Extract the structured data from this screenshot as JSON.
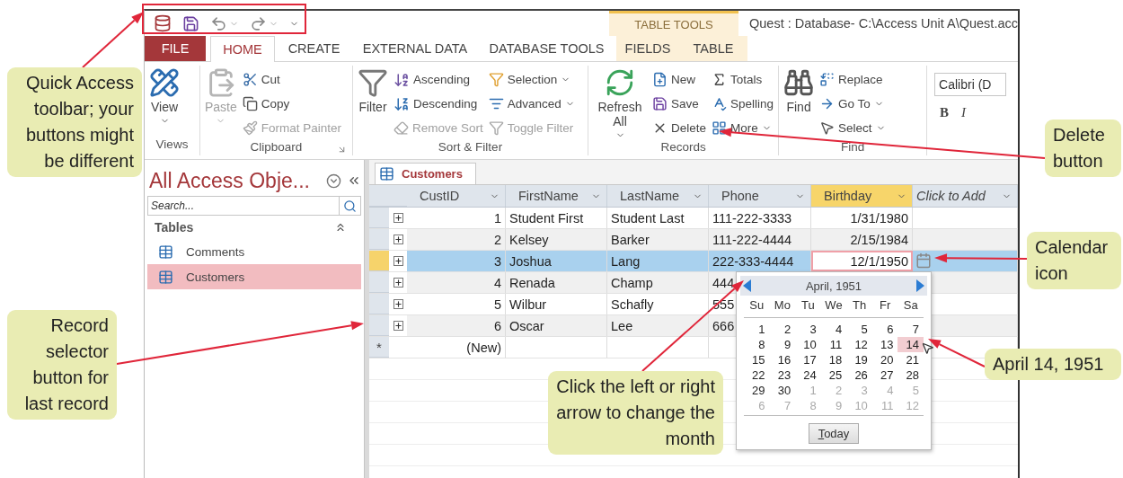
{
  "quick_access": {
    "title": "Quest : Database- C:\\Access Unit A\\Quest.acc",
    "context_group": "TABLE TOOLS"
  },
  "tabs": [
    {
      "label": "FILE",
      "kind": "file",
      "selected": false
    },
    {
      "label": "HOME",
      "kind": "normal",
      "selected": true
    },
    {
      "label": "CREATE",
      "kind": "normal",
      "selected": false
    },
    {
      "label": "EXTERNAL DATA",
      "kind": "normal",
      "selected": false
    },
    {
      "label": "DATABASE TOOLS",
      "kind": "normal",
      "selected": false
    },
    {
      "label": "FIELDS",
      "kind": "contextual",
      "selected": false
    },
    {
      "label": "TABLE",
      "kind": "contextual",
      "selected": false
    }
  ],
  "ribbon": {
    "groups": [
      {
        "label": "Views",
        "launcher": false,
        "large": {
          "label": "View",
          "disabled": false,
          "dropdown": true
        }
      },
      {
        "label": "Clipboard",
        "launcher": true,
        "large": {
          "label": "Paste",
          "disabled": true,
          "dropdown": true
        },
        "columns": [
          [
            {
              "label": "Cut",
              "disabled": false,
              "dropdown": false
            },
            {
              "label": "Copy",
              "disabled": false,
              "dropdown": false
            },
            {
              "label": "Format Painter",
              "disabled": true,
              "dropdown": false
            }
          ]
        ]
      },
      {
        "label": "Sort & Filter",
        "launcher": false,
        "large": {
          "label": "Filter",
          "disabled": false,
          "dropdown": false
        },
        "columns": [
          [
            {
              "label": "Ascending",
              "disabled": false,
              "dropdown": false
            },
            {
              "label": "Descending",
              "disabled": false,
              "dropdown": false
            },
            {
              "label": "Remove Sort",
              "disabled": true,
              "dropdown": false
            }
          ],
          [
            {
              "label": "Selection",
              "disabled": false,
              "dropdown": true
            },
            {
              "label": "Advanced",
              "disabled": false,
              "dropdown": true
            },
            {
              "label": "Toggle Filter",
              "disabled": true,
              "dropdown": false
            }
          ]
        ]
      },
      {
        "label": "Records",
        "launcher": false,
        "large": {
          "label": "Refresh All",
          "disabled": false,
          "dropdown": true
        },
        "columns": [
          [
            {
              "label": "New",
              "disabled": false,
              "dropdown": false
            },
            {
              "label": "Save",
              "disabled": false,
              "dropdown": false
            },
            {
              "label": "Delete",
              "disabled": false,
              "dropdown": false
            }
          ],
          [
            {
              "label": "Totals",
              "disabled": false,
              "dropdown": false
            },
            {
              "label": "Spelling",
              "disabled": false,
              "dropdown": false
            },
            {
              "label": "More",
              "disabled": false,
              "dropdown": true
            }
          ]
        ]
      },
      {
        "label": "Find",
        "launcher": false,
        "large": {
          "label": "Find",
          "disabled": false,
          "dropdown": false
        },
        "columns": [
          [
            {
              "label": "Replace",
              "disabled": false,
              "dropdown": false
            },
            {
              "label": "Go To",
              "disabled": false,
              "dropdown": true
            },
            {
              "label": "Select",
              "disabled": false,
              "dropdown": true
            }
          ]
        ]
      }
    ],
    "font_group": {
      "font": "Calibri (D",
      "buttons": [
        "B",
        "I"
      ]
    }
  },
  "navigation": {
    "title": "All Access Obje...",
    "search": {
      "placeholder": "Search..."
    },
    "groups": [
      {
        "label": "Tables",
        "expanded": true,
        "items": [
          {
            "label": "Comments",
            "selected": false
          },
          {
            "label": "Customers",
            "selected": true
          }
        ]
      }
    ]
  },
  "datasheet": {
    "tab": "Customers",
    "columns": [
      {
        "label": "CustID",
        "kind": "field",
        "selected": false
      },
      {
        "label": "FirstName",
        "kind": "field",
        "selected": false
      },
      {
        "label": "LastName",
        "kind": "field",
        "selected": false
      },
      {
        "label": "Phone",
        "kind": "field",
        "selected": false
      },
      {
        "label": "Birthday",
        "kind": "field",
        "selected": true
      },
      {
        "label": "Click to Add",
        "kind": "add",
        "selected": false
      }
    ],
    "rows": [
      {
        "kind": "record",
        "selected": false,
        "cells": [
          "1",
          "Student First",
          "Student Last",
          "111-222-3333",
          "1/31/1980"
        ]
      },
      {
        "kind": "record",
        "selected": false,
        "cells": [
          "2",
          "Kelsey",
          "Barker",
          "111-222-4444",
          "2/15/1984"
        ]
      },
      {
        "kind": "record",
        "selected": true,
        "cells": [
          "3",
          "Joshua",
          "Lang",
          "222-333-4444",
          "12/1/1950"
        ]
      },
      {
        "kind": "record",
        "selected": false,
        "cells": [
          "4",
          "Renada",
          "Champ",
          "444"
        ]
      },
      {
        "kind": "record",
        "selected": false,
        "cells": [
          "5",
          "Wilbur",
          "Schafly",
          "555"
        ]
      },
      {
        "kind": "record",
        "selected": false,
        "cells": [
          "6",
          "Oscar",
          "Lee",
          "666"
        ]
      },
      {
        "kind": "new",
        "marker": "*",
        "cells": [
          "(New)"
        ]
      }
    ],
    "date_picker": {
      "month": "April, 1951",
      "day_names": [
        "Su",
        "Mo",
        "Tu",
        "We",
        "Th",
        "Fr",
        "Sa"
      ],
      "today_button": "Today",
      "weeks": [
        [
          {
            "label": "1",
            "selected": false,
            "other_month": false
          },
          {
            "label": "2",
            "selected": false,
            "other_month": false
          },
          {
            "label": "3",
            "selected": false,
            "other_month": false
          },
          {
            "label": "4",
            "selected": false,
            "other_month": false
          },
          {
            "label": "5",
            "selected": false,
            "other_month": false
          },
          {
            "label": "6",
            "selected": false,
            "other_month": false
          },
          {
            "label": "7",
            "selected": false,
            "other_month": false
          }
        ],
        [
          {
            "label": "8",
            "selected": false,
            "other_month": false
          },
          {
            "label": "9",
            "selected": false,
            "other_month": false
          },
          {
            "label": "10",
            "selected": false,
            "other_month": false
          },
          {
            "label": "11",
            "selected": false,
            "other_month": false
          },
          {
            "label": "12",
            "selected": false,
            "other_month": false
          },
          {
            "label": "13",
            "selected": false,
            "other_month": false
          },
          {
            "label": "14",
            "selected": true,
            "other_month": false
          }
        ],
        [
          {
            "label": "15",
            "selected": false,
            "other_month": false
          },
          {
            "label": "16",
            "selected": false,
            "other_month": false
          },
          {
            "label": "17",
            "selected": false,
            "other_month": false
          },
          {
            "label": "18",
            "selected": false,
            "other_month": false
          },
          {
            "label": "19",
            "selected": false,
            "other_month": false
          },
          {
            "label": "20",
            "selected": false,
            "other_month": false
          },
          {
            "label": "21",
            "selected": false,
            "other_month": false
          }
        ],
        [
          {
            "label": "22",
            "selected": false,
            "other_month": false
          },
          {
            "label": "23",
            "selected": false,
            "other_month": false
          },
          {
            "label": "24",
            "selected": false,
            "other_month": false
          },
          {
            "label": "25",
            "selected": false,
            "other_month": false
          },
          {
            "label": "26",
            "selected": false,
            "other_month": false
          },
          {
            "label": "27",
            "selected": false,
            "other_month": false
          },
          {
            "label": "28",
            "selected": false,
            "other_month": false
          }
        ],
        [
          {
            "label": "29",
            "selected": false,
            "other_month": false
          },
          {
            "label": "30",
            "selected": false,
            "other_month": false
          },
          {
            "label": "1",
            "selected": false,
            "other_month": true
          },
          {
            "label": "2",
            "selected": false,
            "other_month": true
          },
          {
            "label": "3",
            "selected": false,
            "other_month": true
          },
          {
            "label": "4",
            "selected": false,
            "other_month": true
          },
          {
            "label": "5",
            "selected": false,
            "other_month": true
          }
        ],
        [
          {
            "label": "6",
            "selected": false,
            "other_month": true
          },
          {
            "label": "7",
            "selected": false,
            "other_month": true
          },
          {
            "label": "8",
            "selected": false,
            "other_month": true
          },
          {
            "label": "9",
            "selected": false,
            "other_month": true
          },
          {
            "label": "10",
            "selected": false,
            "other_month": true
          },
          {
            "label": "11",
            "selected": false,
            "other_month": true
          },
          {
            "label": "12",
            "selected": false,
            "other_month": true
          }
        ]
      ]
    }
  },
  "callouts": [
    {
      "text": "Quick Access toolbar; your buttons might be different"
    },
    {
      "text": "Record selector button for last record"
    },
    {
      "text": "Delete button"
    },
    {
      "text": "Calendar icon"
    },
    {
      "text": "April 14, 1951"
    },
    {
      "text": "Click the left or right arrow to change the month"
    }
  ]
}
